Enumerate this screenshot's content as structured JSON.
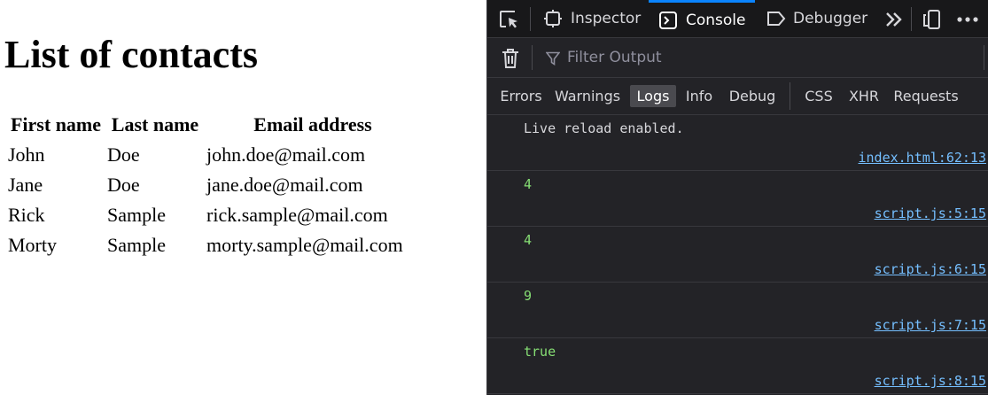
{
  "page": {
    "title": "List of contacts",
    "table": {
      "headers": [
        "First name",
        "Last name",
        "Email address"
      ],
      "rows": [
        [
          "John",
          "Doe",
          "john.doe@mail.com"
        ],
        [
          "Jane",
          "Doe",
          "jane.doe@mail.com"
        ],
        [
          "Rick",
          "Sample",
          "rick.sample@mail.com"
        ],
        [
          "Morty",
          "Sample",
          "morty.sample@mail.com"
        ]
      ]
    }
  },
  "devtools": {
    "tabs": {
      "inspector": "Inspector",
      "console": "Console",
      "debugger": "Debugger"
    },
    "selected_tab": "Console",
    "accent_color": "#0a84ff",
    "toolbar": {
      "filter_placeholder": "Filter Output"
    },
    "filters": {
      "errors": "Errors",
      "warnings": "Warnings",
      "logs": "Logs",
      "info": "Info",
      "debug": "Debug",
      "css": "CSS",
      "xhr": "XHR",
      "requests": "Requests"
    },
    "active_filter": "Logs",
    "messages": [
      {
        "text": "Live reload enabled.",
        "location": "index.html:62:13",
        "kind": "string"
      },
      {
        "text": "4",
        "location": "script.js:5:15",
        "kind": "number"
      },
      {
        "text": "4",
        "location": "script.js:6:15",
        "kind": "number"
      },
      {
        "text": "9",
        "location": "script.js:7:15",
        "kind": "number"
      },
      {
        "text": "true",
        "location": "script.js:8:15",
        "kind": "boolean"
      }
    ]
  }
}
